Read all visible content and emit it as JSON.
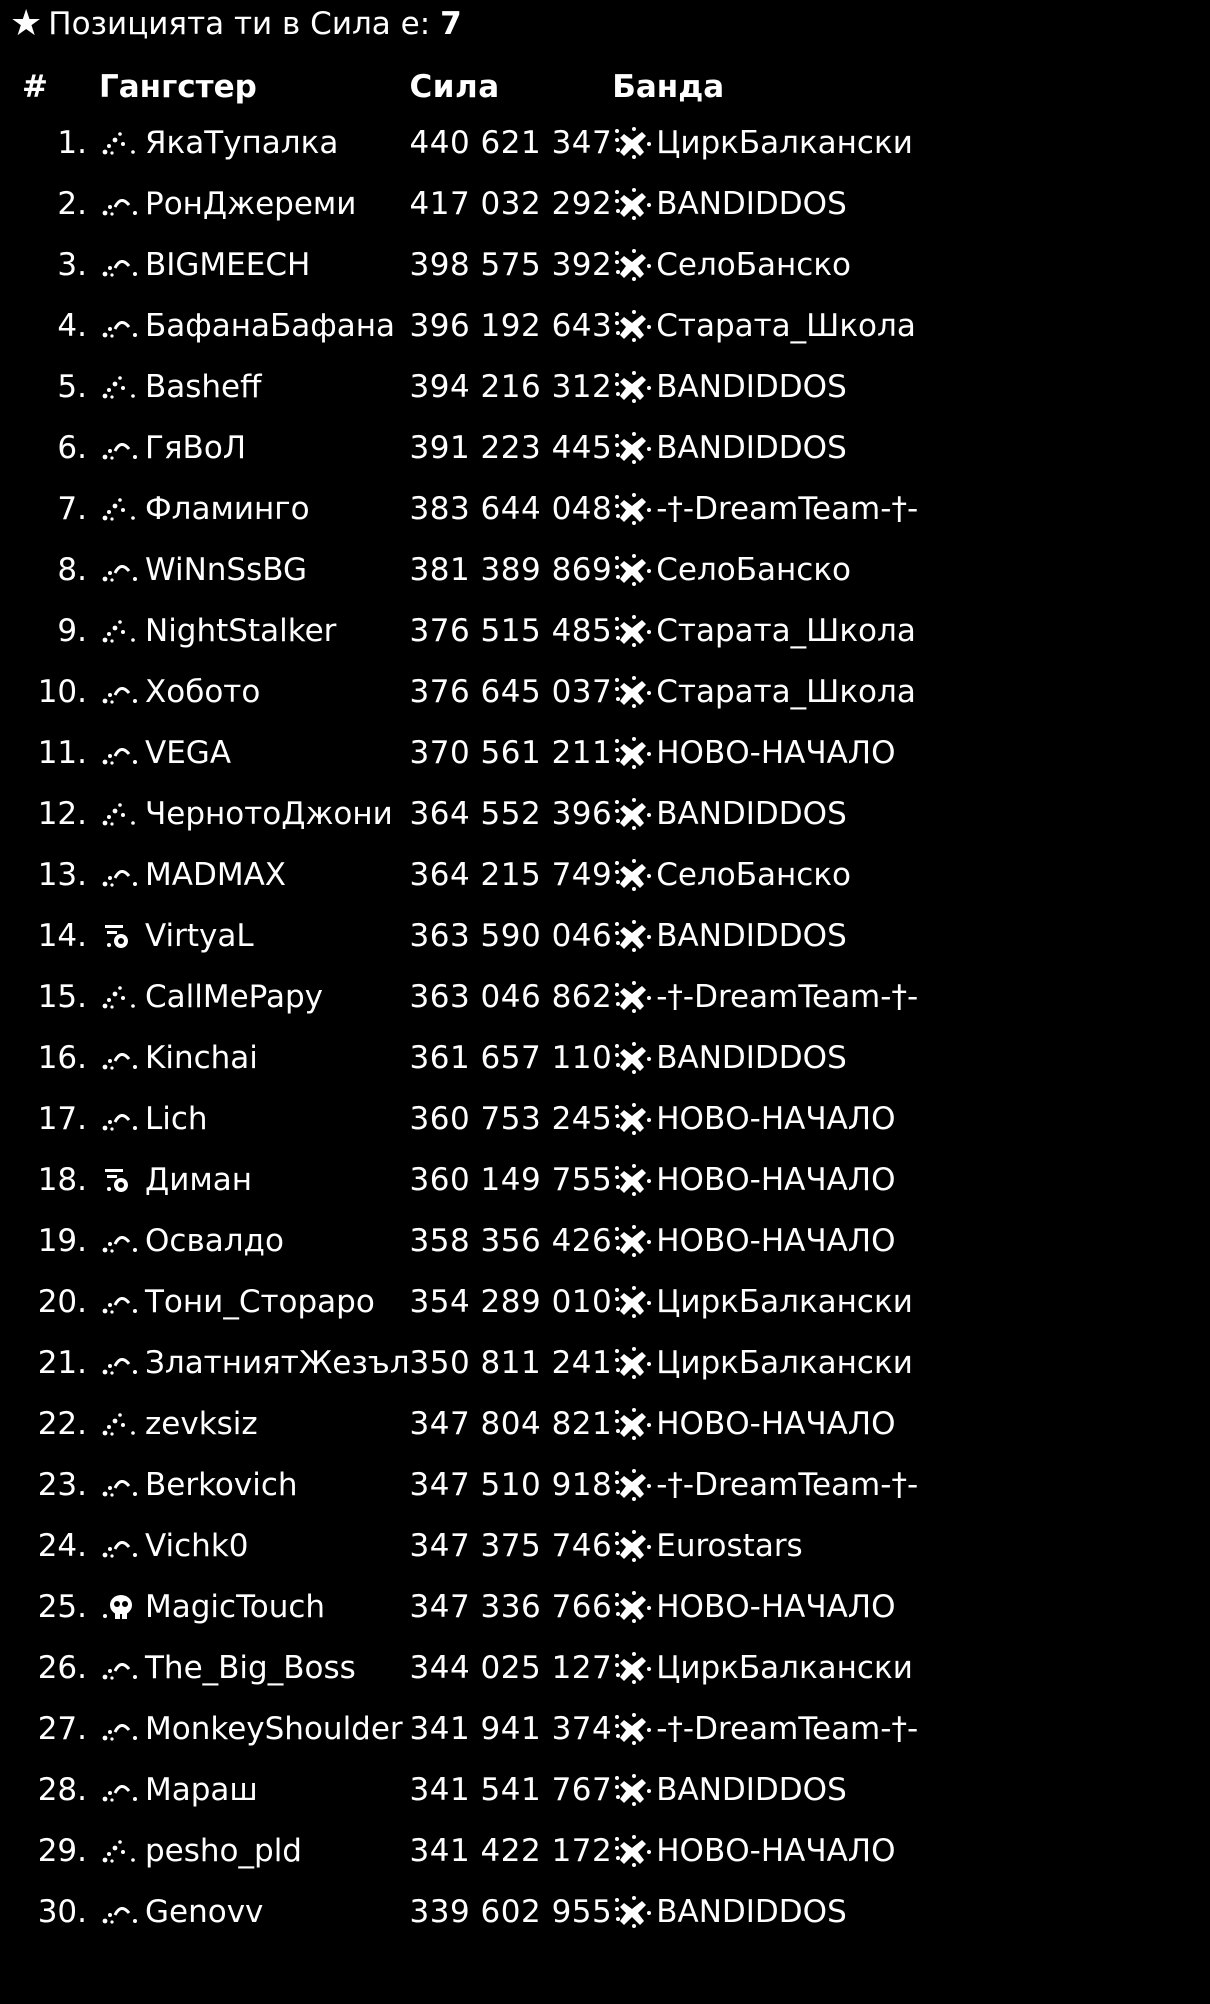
{
  "position": {
    "star_icon": "star-icon",
    "label": "Позицията ти в Сила е:",
    "value": "7"
  },
  "table": {
    "headers": {
      "rank": "#",
      "player": "Гангстер",
      "power": "Сила",
      "gang": "Банда"
    },
    "rows": [
      {
        "rank": "1.",
        "player": "ЯкаТупалка",
        "power": "440 621 347",
        "gang": "ЦиркБалкански",
        "rank_icon": "rank-dots-icon"
      },
      {
        "rank": "2.",
        "player": "РонДжереми",
        "power": "417 032 292",
        "gang": "BANDIDDOS",
        "rank_icon": "rank-arc-icon"
      },
      {
        "rank": "3.",
        "player": "BIGMEECH",
        "power": "398 575 392",
        "gang": "СелоБанско",
        "rank_icon": "rank-arc-icon"
      },
      {
        "rank": "4.",
        "player": "БафанаБафана",
        "power": "396 192 643",
        "gang": "Старата_Школа",
        "rank_icon": "rank-arc-icon"
      },
      {
        "rank": "5.",
        "player": "Basheff",
        "power": "394 216 312",
        "gang": "BANDIDDOS",
        "rank_icon": "rank-dots-icon"
      },
      {
        "rank": "6.",
        "player": "ГяВоЛ",
        "power": "391 223 445",
        "gang": "BANDIDDOS",
        "rank_icon": "rank-arc-icon"
      },
      {
        "rank": "7.",
        "player": "Фламинго",
        "power": "383 644 048",
        "gang": "-†-DreamTeam-†-",
        "rank_icon": "rank-dots-icon"
      },
      {
        "rank": "8.",
        "player": "WiNnSsBG",
        "power": "381 389 869",
        "gang": "СелоБанско",
        "rank_icon": "rank-arc-icon"
      },
      {
        "rank": "9.",
        "player": "NightStalker",
        "power": "376 515 485",
        "gang": "Старата_Школа",
        "rank_icon": "rank-dots-icon"
      },
      {
        "rank": "10.",
        "player": "Хобото",
        "power": "376 645 037",
        "gang": "Старата_Школа",
        "rank_icon": "rank-arc-icon"
      },
      {
        "rank": "11.",
        "player": "VEGA",
        "power": "370 561 211",
        "gang": "НОВО-НАЧАЛО",
        "rank_icon": "rank-arc-icon"
      },
      {
        "rank": "12.",
        "player": "ЧернотоДжони",
        "power": "364 552 396",
        "gang": "BANDIDDOS",
        "rank_icon": "rank-dots-icon"
      },
      {
        "rank": "13.",
        "player": "MADMAX",
        "power": "364 215 749",
        "gang": "СелоБанско",
        "rank_icon": "rank-arc-icon"
      },
      {
        "rank": "14.",
        "player": "VirtyaL",
        "power": "363 590 046",
        "gang": "BANDIDDOS",
        "rank_icon": "rank-gear-icon"
      },
      {
        "rank": "15.",
        "player": "CallMePapy",
        "power": "363 046 862",
        "gang": "-†-DreamTeam-†-",
        "rank_icon": "rank-dots-icon"
      },
      {
        "rank": "16.",
        "player": "Kinchai",
        "power": "361 657 110",
        "gang": "BANDIDDOS",
        "rank_icon": "rank-arc-icon"
      },
      {
        "rank": "17.",
        "player": "Lich",
        "power": "360 753 245",
        "gang": "НОВО-НАЧАЛО",
        "rank_icon": "rank-arc-icon"
      },
      {
        "rank": "18.",
        "player": "Диман",
        "power": "360 149 755",
        "gang": "НОВО-НАЧАЛО",
        "rank_icon": "rank-gear-icon"
      },
      {
        "rank": "19.",
        "player": "Освалдо",
        "power": "358 356 426",
        "gang": "НОВО-НАЧАЛО",
        "rank_icon": "rank-arc-icon"
      },
      {
        "rank": "20.",
        "player": "Тони_Стораро",
        "power": "354 289 010",
        "gang": "ЦиркБалкански",
        "rank_icon": "rank-arc-icon"
      },
      {
        "rank": "21.",
        "player": "ЗлатниятЖезъл",
        "power": "350 811 241",
        "gang": "ЦиркБалкански",
        "rank_icon": "rank-arc-icon"
      },
      {
        "rank": "22.",
        "player": "zevksiz",
        "power": "347 804 821",
        "gang": "НОВО-НАЧАЛО",
        "rank_icon": "rank-dots-icon"
      },
      {
        "rank": "23.",
        "player": "Berkovich",
        "power": "347 510 918",
        "gang": "-†-DreamTeam-†-",
        "rank_icon": "rank-arc-icon"
      },
      {
        "rank": "24.",
        "player": "Vichk0",
        "power": "347 375 746",
        "gang": "Eurostars",
        "rank_icon": "rank-arc-icon"
      },
      {
        "rank": "25.",
        "player": "MagicTouch",
        "power": "347 336 766",
        "gang": "НОВО-НАЧАЛО",
        "rank_icon": "rank-skull-icon"
      },
      {
        "rank": "26.",
        "player": "The_Big_Boss",
        "power": "344 025 127",
        "gang": "ЦиркБалкански",
        "rank_icon": "rank-arc-icon"
      },
      {
        "rank": "27.",
        "player": "MonkeyShoulder",
        "power": "341 941 374",
        "gang": "-†-DreamTeam-†-",
        "rank_icon": "rank-arc-icon"
      },
      {
        "rank": "28.",
        "player": "Мараш",
        "power": "341 541 767",
        "gang": "BANDIDDOS",
        "rank_icon": "rank-arc-icon"
      },
      {
        "rank": "29.",
        "player": "pesho_pld",
        "power": "341 422 172",
        "gang": "НОВО-НАЧАЛО",
        "rank_icon": "rank-dots-icon"
      },
      {
        "rank": "30.",
        "player": "Genovv",
        "power": "339 602 955",
        "gang": "BANDIDDOS",
        "rank_icon": "rank-arc-icon"
      }
    ],
    "gang_icon": "gang-emblem-icon"
  }
}
